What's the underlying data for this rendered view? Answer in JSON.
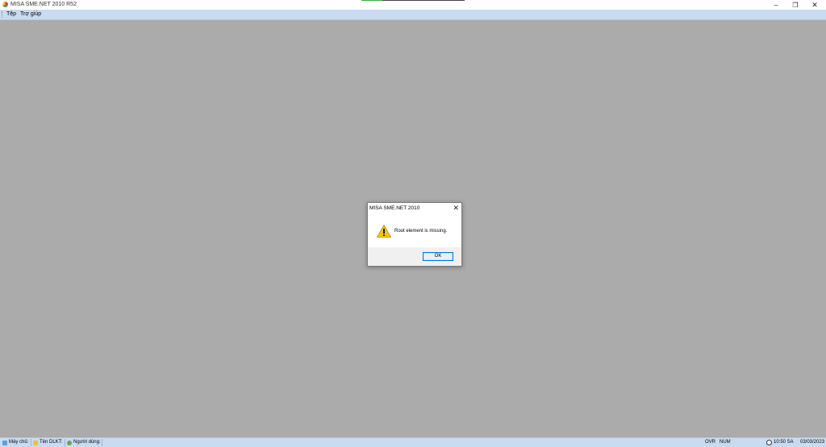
{
  "window": {
    "title": "MISA SME.NET 2010 R52",
    "minimize_icon": "minimize-icon",
    "restore_icon": "restore-icon",
    "close_icon": "close-icon",
    "progress": 0.2
  },
  "menubar": {
    "items": [
      {
        "label": "Tệp"
      },
      {
        "label": "Trợ giúp"
      }
    ]
  },
  "dialog": {
    "title": "MISA SME.NET 2010",
    "message": "Root element is missing.",
    "icon": "warning-icon",
    "ok_label": "OK"
  },
  "statusbar": {
    "server": "Máy chủ:",
    "db": "Tên DLKT:",
    "user": "Người dùng:",
    "ovr": "OVR",
    "num": "NUM",
    "time": "10:50 SA",
    "date": "03/03/2023"
  },
  "colors": {
    "workspace": "#ababab",
    "menubar": "#c9dbf1",
    "accent": "#0078d7"
  }
}
